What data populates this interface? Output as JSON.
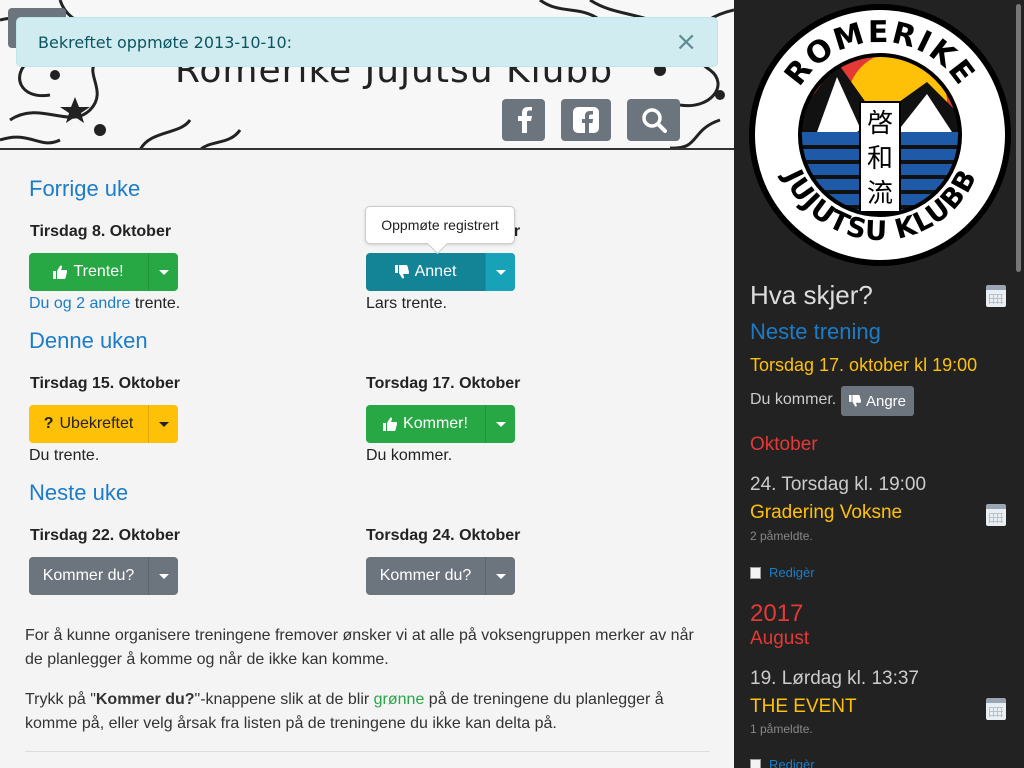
{
  "site": {
    "title": "Romerike Jujutsu Klubb"
  },
  "alert": {
    "text": "Bekreftet oppmøte 2013-10-10:",
    "close": "×"
  },
  "header_buttons": [
    {
      "icon": "facebook-icon"
    },
    {
      "icon": "facebook-square-icon"
    },
    {
      "icon": "search-icon"
    }
  ],
  "weeks": {
    "prev": {
      "title": "Forrige uke",
      "day1": {
        "title": "Tirsdag 8. Oktober",
        "button": "Trente!",
        "link": "Du og 2 andre",
        "after": " trente."
      },
      "day2": {
        "title": "Torsdag 10. Oktober",
        "title_visible": "er",
        "button": "Annet",
        "text": "Lars trente.",
        "tooltip": "Oppmøte registrert"
      }
    },
    "this": {
      "title": "Denne uken",
      "day1": {
        "title": "Tirsdag 15. Oktober",
        "button": "Ubekreftet",
        "text": "Du trente."
      },
      "day2": {
        "title": "Torsdag 17. Oktober",
        "button": "Kommer!",
        "text": "Du kommer."
      }
    },
    "next": {
      "title": "Neste uke",
      "day1": {
        "title": "Tirsdag 22. Oktober",
        "button": "Kommer du?"
      },
      "day2": {
        "title": "Torsdag 24. Oktober",
        "button": "Kommer du?"
      }
    }
  },
  "info": {
    "p1": "For å kunne organisere treningene fremover ønsker vi at alle på voksengruppen merker av når de planlegger å komme og når de ikke kan komme.",
    "p2_a": "Trykk på \"",
    "p2_b": "Kommer du?",
    "p2_c": "\"-knappene slik at de blir ",
    "p2_d": "grønne",
    "p2_e": " på de treningene du planlegger å komme på, eller velg årsak fra listen på de treningene du ikke kan delta på."
  },
  "sidebar": {
    "logo": {
      "top": "ROMERIKE",
      "bottom": "JUJUTSU KLUBB",
      "kanji": [
        "啓",
        "和",
        "流"
      ]
    },
    "title": "Hva skjer?",
    "next_training": "Neste trening",
    "next_date": "Torsdag 17. oktober kl 19:00",
    "status": "Du kommer.",
    "undo": "Angre",
    "month1": "Oktober",
    "event1": {
      "date": "24. Torsdag kl. 19:00",
      "name": "Gradering Voksne",
      "count": "2 påmeldte.",
      "edit": "Redigèr"
    },
    "year2": "2017",
    "month2": "August",
    "event2": {
      "date": "19. Lørdag kl. 13:37",
      "name": "THE EVENT",
      "count": "1 påmeldte.",
      "edit": "Redigèr"
    }
  },
  "colors": {
    "primary": "#1c7cc7",
    "success": "#28a745",
    "warning": "#ffc107",
    "info": "#17a2b8",
    "secondary": "#6c757d",
    "sidebar_bg": "#222222",
    "event_orange": "#ffc107",
    "month_red": "#e53935"
  }
}
